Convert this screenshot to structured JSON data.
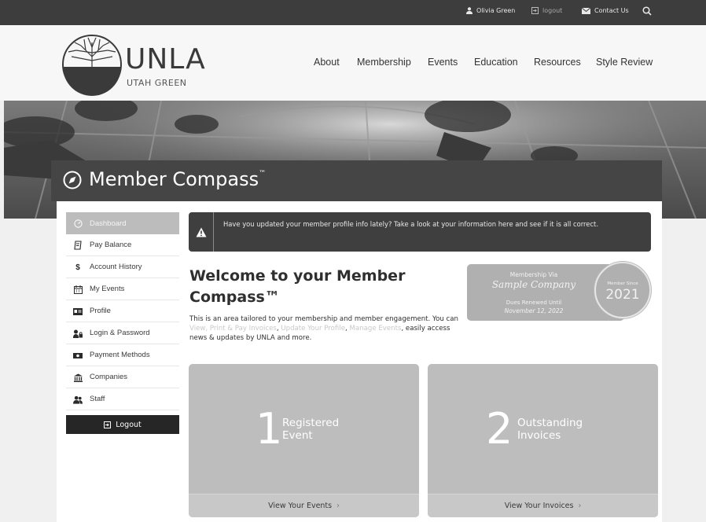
{
  "topbar": {
    "user_name": "Olivia Green",
    "logout": "logout",
    "contact": "Contact Us"
  },
  "logo": {
    "word": "UNLA",
    "sub": "UTAH GREEN"
  },
  "nav": [
    "About",
    "Membership",
    "Events",
    "Education",
    "Resources",
    "Style Review"
  ],
  "page_title": "Member Compass",
  "page_title_tm": "™",
  "sidebar": {
    "items": [
      {
        "label": "Dashboard",
        "icon": "dashboard-icon",
        "active": true
      },
      {
        "label": "Pay Balance",
        "icon": "receipt-icon"
      },
      {
        "label": "Account History",
        "icon": "dollar-icon"
      },
      {
        "label": "My Events",
        "icon": "calendar-icon"
      },
      {
        "label": "Profile",
        "icon": "id-card-icon"
      },
      {
        "label": "Login & Password",
        "icon": "user-lock-icon"
      },
      {
        "label": "Payment Methods",
        "icon": "money-icon"
      },
      {
        "label": "Companies",
        "icon": "building-icon"
      },
      {
        "label": "Staff",
        "icon": "users-icon"
      }
    ],
    "logout_label": "Logout"
  },
  "alert": {
    "text": "Have you updated your member profile info lately? Take a look at your information here and see if it is all correct."
  },
  "welcome": {
    "heading": "Welcome to your Member Compass™",
    "intro_a": "This is an area tailored to your membership and member engagement. You can ",
    "link1": "View, Print & Pay Invoices",
    "sep1": ", ",
    "link2": "Update Your Profile",
    "sep2": ", ",
    "link3": "Manage Events",
    "intro_b": ", easily access news & updates by UNLA and more."
  },
  "membership_card": {
    "via_label": "Membership Via",
    "company": "Sample Company",
    "renewed_label": "Dues Renewed Until",
    "renewed_date": "November 12, 2022",
    "since_label": "Member Since",
    "since_year": "2021"
  },
  "tiles": [
    {
      "number": "1",
      "label_line1": "Registered",
      "label_line2": "Event",
      "footer": "View Your Events"
    },
    {
      "number": "2",
      "label_line1": "Outstanding",
      "label_line2": "Invoices",
      "footer": "View Your Invoices"
    }
  ],
  "colors": {
    "topbar": "#3d3d3d",
    "title_bar": "#454545",
    "alert_bg": "#3f3f3f",
    "tile_bg": "#bdbdbd",
    "active_nav": "#bcbcbc"
  }
}
